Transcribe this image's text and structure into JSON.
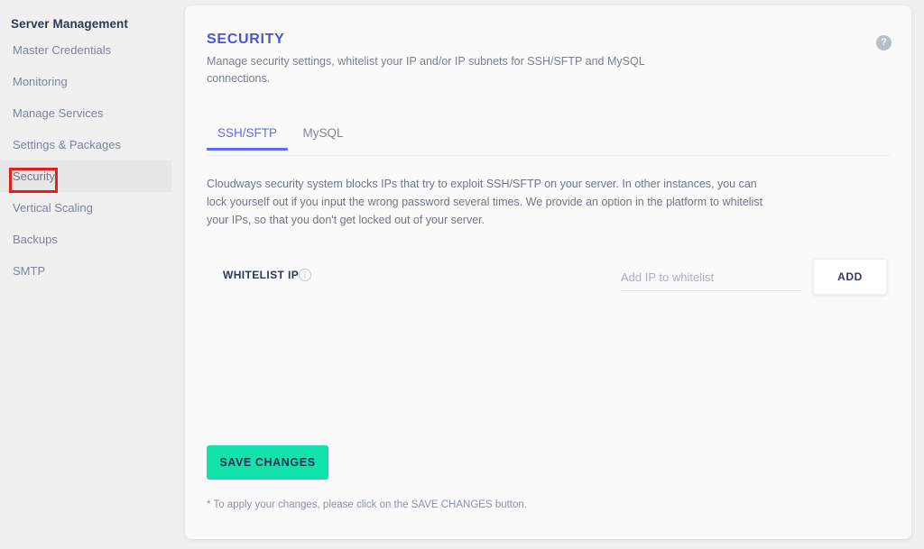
{
  "sidebar": {
    "title": "Server Management",
    "items": [
      {
        "label": "Master Credentials",
        "active": false
      },
      {
        "label": "Monitoring",
        "active": false
      },
      {
        "label": "Manage Services",
        "active": false
      },
      {
        "label": "Settings & Packages",
        "active": false
      },
      {
        "label": "Security",
        "active": true
      },
      {
        "label": "Vertical Scaling",
        "active": false
      },
      {
        "label": "Backups",
        "active": false
      },
      {
        "label": "SMTP",
        "active": false
      }
    ]
  },
  "card": {
    "title": "SECURITY",
    "subtitle": "Manage security settings, whitelist your IP and/or IP subnets for SSH/SFTP and MySQL connections.",
    "help_icon": "help-circle-icon",
    "help_glyph": "?",
    "tabs": [
      {
        "label": "SSH/SFTP",
        "active": true
      },
      {
        "label": "MySQL",
        "active": false
      }
    ],
    "body_text": "Cloudways security system blocks IPs that try to exploit SSH/SFTP on your server. In other instances, you can lock yourself out if you input the wrong password several times. We provide an option in the platform to whitelist your IPs, so that you don't get locked out of your server.",
    "whitelist": {
      "label": "WHITELIST IP",
      "info_icon": "info-circle-icon",
      "info_glyph": "i",
      "input_value": "",
      "input_placeholder": "Add IP to whitelist",
      "add_label": "ADD"
    },
    "save_label": "SAVE CHANGES",
    "footer_note": "* To apply your changes, please click on the SAVE CHANGES button."
  },
  "annotation": {
    "name": "red-highlight-box",
    "color": "#ee1b1b",
    "target": "Security"
  },
  "colors": {
    "page_background": "#f0f0f1",
    "card_background": "#fafafb",
    "accent_indigo": "#5b6cfa",
    "title_indigo": "#4a55d6",
    "save_green": "#11e3ab",
    "navy_text": "#2b3a52",
    "muted_text": "#77808f",
    "annotation_red": "#ee1b1b"
  }
}
